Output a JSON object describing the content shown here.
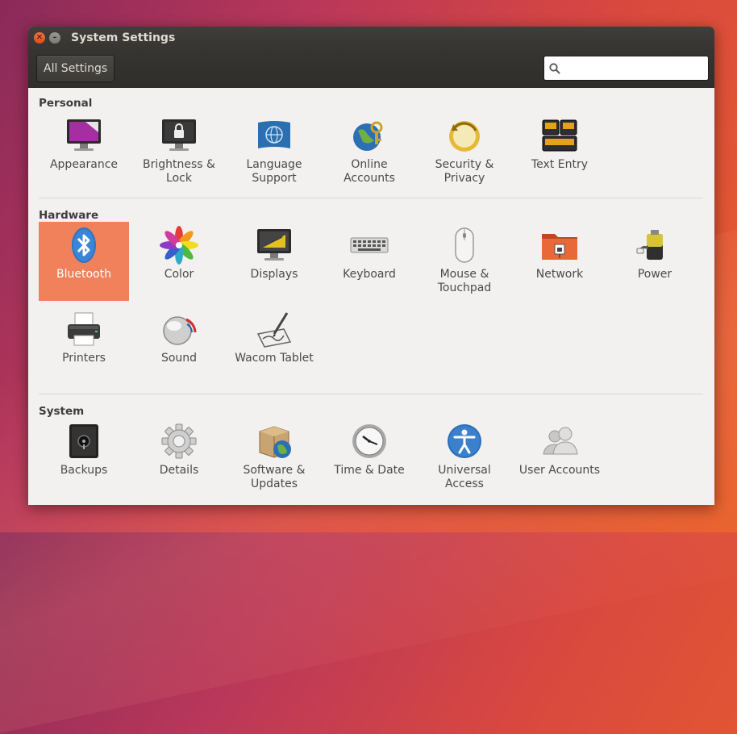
{
  "window": {
    "title": "System Settings"
  },
  "toolbar": {
    "all_settings_label": "All Settings",
    "search_value": "",
    "search_placeholder": ""
  },
  "sections": {
    "personal": {
      "title": "Personal",
      "items": [
        {
          "label": "Appearance",
          "icon": "appearance-icon"
        },
        {
          "label": "Brightness & Lock",
          "icon": "brightness-lock-icon"
        },
        {
          "label": "Language Support",
          "icon": "language-support-icon"
        },
        {
          "label": "Online Accounts",
          "icon": "online-accounts-icon"
        },
        {
          "label": "Security & Privacy",
          "icon": "security-privacy-icon"
        },
        {
          "label": "Text Entry",
          "icon": "text-entry-icon"
        }
      ]
    },
    "hardware": {
      "title": "Hardware",
      "items": [
        {
          "label": "Bluetooth",
          "icon": "bluetooth-icon",
          "selected": true
        },
        {
          "label": "Color",
          "icon": "color-icon"
        },
        {
          "label": "Displays",
          "icon": "displays-icon"
        },
        {
          "label": "Keyboard",
          "icon": "keyboard-icon"
        },
        {
          "label": "Mouse & Touchpad",
          "icon": "mouse-icon"
        },
        {
          "label": "Network",
          "icon": "network-icon"
        },
        {
          "label": "Power",
          "icon": "power-icon"
        },
        {
          "label": "Printers",
          "icon": "printer-icon"
        },
        {
          "label": "Sound",
          "icon": "sound-icon"
        },
        {
          "label": "Wacom Tablet",
          "icon": "wacom-tablet-icon"
        }
      ]
    },
    "system": {
      "title": "System",
      "items": [
        {
          "label": "Backups",
          "icon": "backups-icon"
        },
        {
          "label": "Details",
          "icon": "details-gear-icon"
        },
        {
          "label": "Software & Updates",
          "icon": "software-updates-icon"
        },
        {
          "label": "Time & Date",
          "icon": "clock-icon"
        },
        {
          "label": "Universal Access",
          "icon": "universal-access-icon"
        },
        {
          "label": "User Accounts",
          "icon": "user-accounts-icon"
        }
      ]
    }
  },
  "colors": {
    "selection": "#f0815a",
    "titlebar": "#3c3b37",
    "background": "#f2f1f0"
  }
}
